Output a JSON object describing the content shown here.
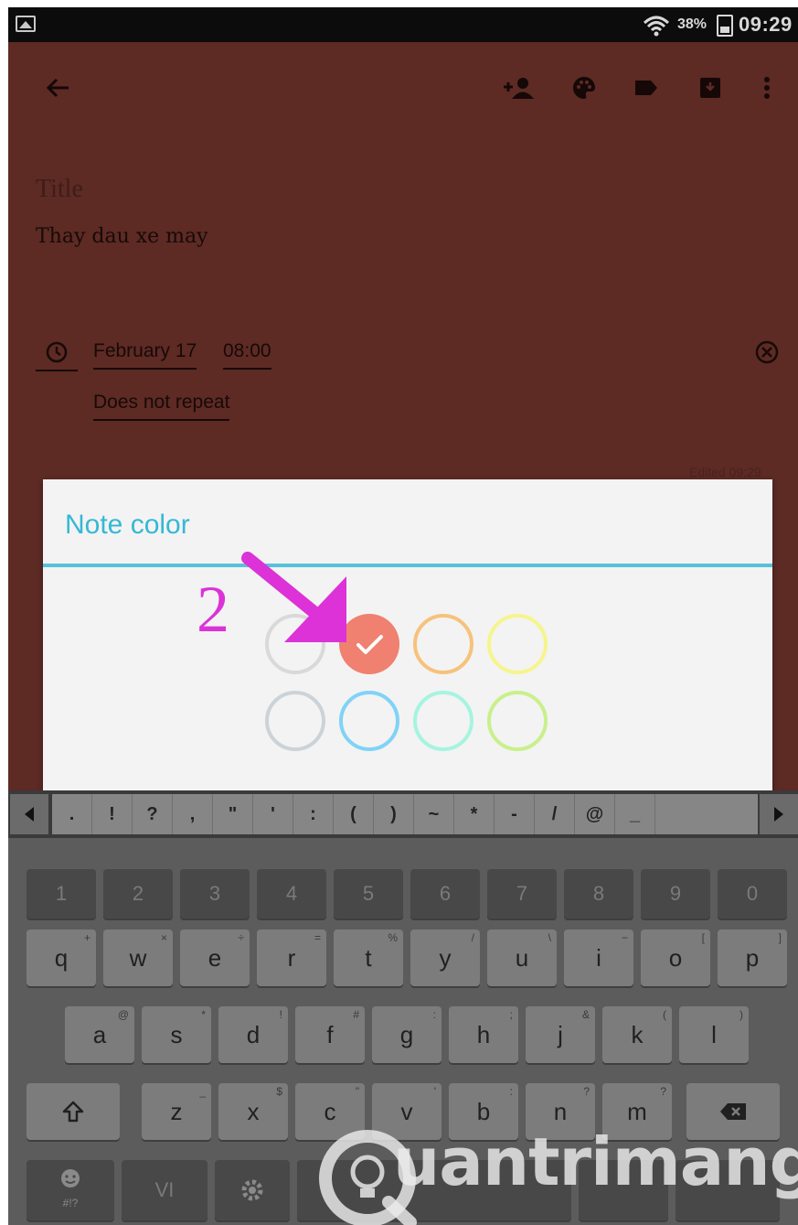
{
  "status_bar": {
    "battery_percent": "38%",
    "time": "09:29"
  },
  "toolbar": {
    "icons": [
      "back-arrow-icon",
      "add-collaborator-icon",
      "palette-icon",
      "label-icon",
      "archive-icon",
      "more-vert-icon"
    ]
  },
  "note": {
    "title_placeholder": "Title",
    "body": "Thay dau xe may",
    "reminder_date": "February 17",
    "reminder_time": "08:00",
    "repeat": "Does not repeat",
    "edited": "Edited 09:29"
  },
  "dialog": {
    "title": "Note color",
    "annotation_number": "2",
    "colors": [
      {
        "name": "white",
        "hex": "#d9d9d9",
        "selected": false
      },
      {
        "name": "red",
        "hex": "#f0806f",
        "selected": true
      },
      {
        "name": "orange",
        "hex": "#f6c27c",
        "selected": false
      },
      {
        "name": "yellow",
        "hex": "#f6f58c",
        "selected": false
      },
      {
        "name": "gray",
        "hex": "#cbd3d8",
        "selected": false
      },
      {
        "name": "blue",
        "hex": "#7fd3f6",
        "selected": false
      },
      {
        "name": "teal",
        "hex": "#a6f4e0",
        "selected": false
      },
      {
        "name": "green",
        "hex": "#c9f08b",
        "selected": false
      }
    ],
    "accent": "#35b8d4",
    "annotation_color": "#dc32d7"
  },
  "keyboard": {
    "symbols": [
      ".",
      "!",
      "?",
      ",",
      "\"",
      "'",
      ":",
      "(",
      ")",
      "~",
      "*",
      "-",
      "/",
      "@",
      "_"
    ],
    "numbers": [
      "1",
      "2",
      "3",
      "4",
      "5",
      "6",
      "7",
      "8",
      "9",
      "0"
    ],
    "row1": [
      {
        "k": "q",
        "h": "+"
      },
      {
        "k": "w",
        "h": "×"
      },
      {
        "k": "e",
        "h": "÷"
      },
      {
        "k": "r",
        "h": "="
      },
      {
        "k": "t",
        "h": "%"
      },
      {
        "k": "y",
        "h": "/"
      },
      {
        "k": "u",
        "h": "\\"
      },
      {
        "k": "i",
        "h": "−"
      },
      {
        "k": "o",
        "h": "["
      },
      {
        "k": "p",
        "h": "]"
      }
    ],
    "row2": [
      {
        "k": "a",
        "h": "@"
      },
      {
        "k": "s",
        "h": "*"
      },
      {
        "k": "d",
        "h": "!"
      },
      {
        "k": "f",
        "h": "#"
      },
      {
        "k": "g",
        "h": ":"
      },
      {
        "k": "h",
        "h": ";"
      },
      {
        "k": "j",
        "h": "&"
      },
      {
        "k": "k",
        "h": "("
      },
      {
        "k": "l",
        "h": ")"
      }
    ],
    "row3": [
      {
        "k": "z",
        "h": "_"
      },
      {
        "k": "x",
        "h": "$"
      },
      {
        "k": "c",
        "h": "\""
      },
      {
        "k": "v",
        "h": "'"
      },
      {
        "k": "b",
        "h": ":"
      },
      {
        "k": "n",
        "h": "?"
      },
      {
        "k": "m",
        "h": "?"
      }
    ],
    "emoji_sub": "#!?",
    "language": "VI"
  },
  "watermark": {
    "text": "uantrimang"
  }
}
